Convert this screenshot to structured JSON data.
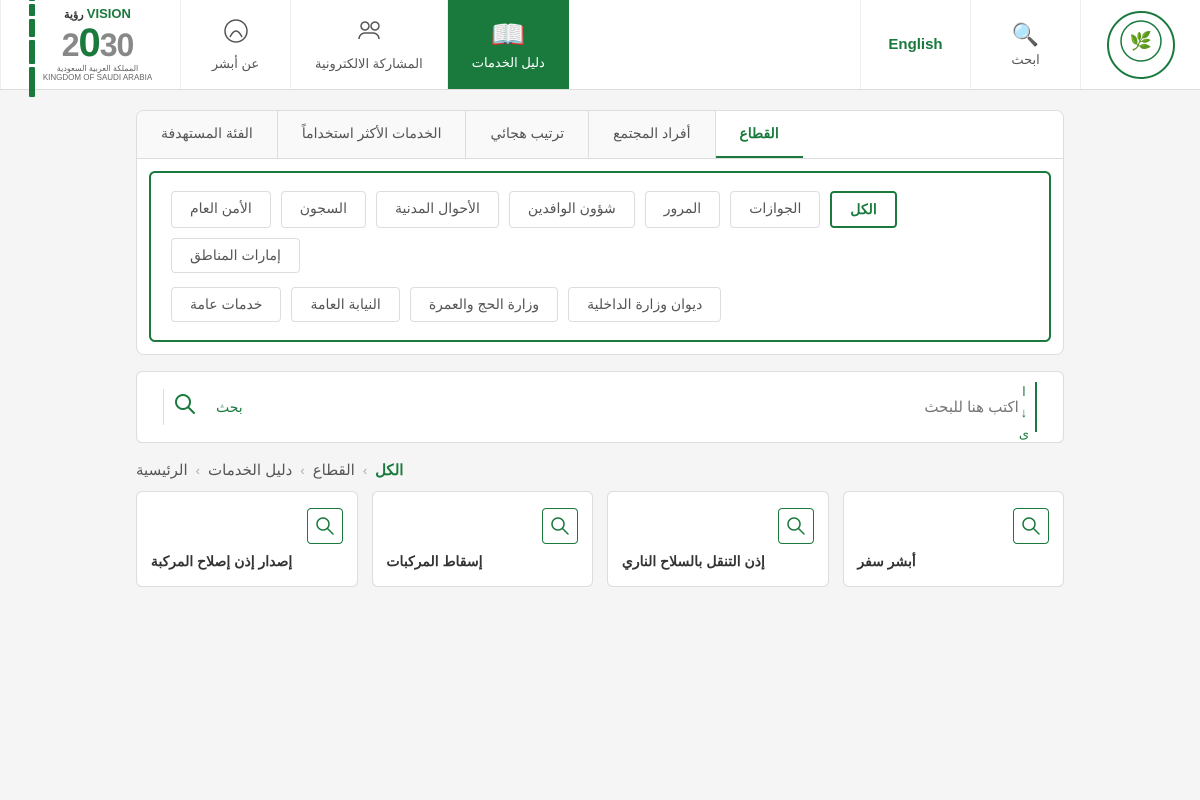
{
  "header": {
    "logo_alt": "Saudi Government Logo",
    "search_label": "ابحث",
    "english_label": "English",
    "nav_items": [
      {
        "id": "daleel",
        "label": "دليل الخدمات",
        "icon": "📖",
        "active": true
      },
      {
        "id": "musharaka",
        "label": "المشاركة الالكترونية",
        "icon": "👥",
        "active": false
      },
      {
        "id": "absher",
        "label": "عن أبشر",
        "icon": "🔵",
        "active": false
      }
    ],
    "vision": {
      "top": "VISION رؤية",
      "number": "2030",
      "sub": "المملكة العربية السعودية\nKINGDOM OF SAUDI ARABIA"
    }
  },
  "filters": {
    "top_tabs": [
      {
        "id": "sector",
        "label": "القطاع",
        "active": true
      },
      {
        "id": "society",
        "label": "أفراد المجتمع",
        "active": false
      },
      {
        "id": "alphabetical",
        "label": "ترتيب هجائي",
        "active": false
      },
      {
        "id": "most_used",
        "label": "الخدمات الأكثر استخداماً",
        "active": false
      },
      {
        "id": "target",
        "label": "الفئة المستهدفة",
        "active": false
      }
    ],
    "sub_tags": [
      {
        "id": "all",
        "label": "الكل",
        "active": true
      },
      {
        "id": "passports",
        "label": "الجوازات",
        "active": false
      },
      {
        "id": "traffic",
        "label": "المرور",
        "active": false
      },
      {
        "id": "expats",
        "label": "شؤون الوافدين",
        "active": false
      },
      {
        "id": "civil",
        "label": "الأحوال المدنية",
        "active": false
      },
      {
        "id": "prison",
        "label": "السجون",
        "active": false
      },
      {
        "id": "security",
        "label": "الأمن العام",
        "active": false
      },
      {
        "id": "emirates",
        "label": "إمارات المناطق",
        "active": false
      },
      {
        "id": "interior",
        "label": "ديوان وزارة الداخلية",
        "active": false
      },
      {
        "id": "hajj",
        "label": "وزارة الحج والعمرة",
        "active": false
      },
      {
        "id": "prosecution",
        "label": "النيابة العامة",
        "active": false
      },
      {
        "id": "general",
        "label": "خدمات عامة",
        "active": false
      }
    ]
  },
  "search": {
    "placeholder": "اكتب هنا للبحث",
    "button_label": "بحث",
    "deco_chars": [
      "ا",
      "↓",
      "ى"
    ]
  },
  "breadcrumb": {
    "items": [
      {
        "label": "الرئيسية",
        "active": false
      },
      {
        "sep": "‹"
      },
      {
        "label": "دليل الخدمات",
        "active": false
      },
      {
        "sep": "‹"
      },
      {
        "label": "القطاع",
        "active": false
      },
      {
        "sep": "‹"
      },
      {
        "label": "الكل",
        "active": true
      }
    ]
  },
  "service_cards": [
    {
      "id": "card1",
      "title": "أبشر سفر",
      "icon": "🔍"
    },
    {
      "id": "card2",
      "title": "إذن التنقل بالسلاح الناري",
      "icon": "🔍"
    },
    {
      "id": "card3",
      "title": "إسقاط المركبات",
      "icon": "🔍"
    },
    {
      "id": "card4",
      "title": "إصدار إذن إصلاح المركبة",
      "icon": "🔍"
    }
  ]
}
